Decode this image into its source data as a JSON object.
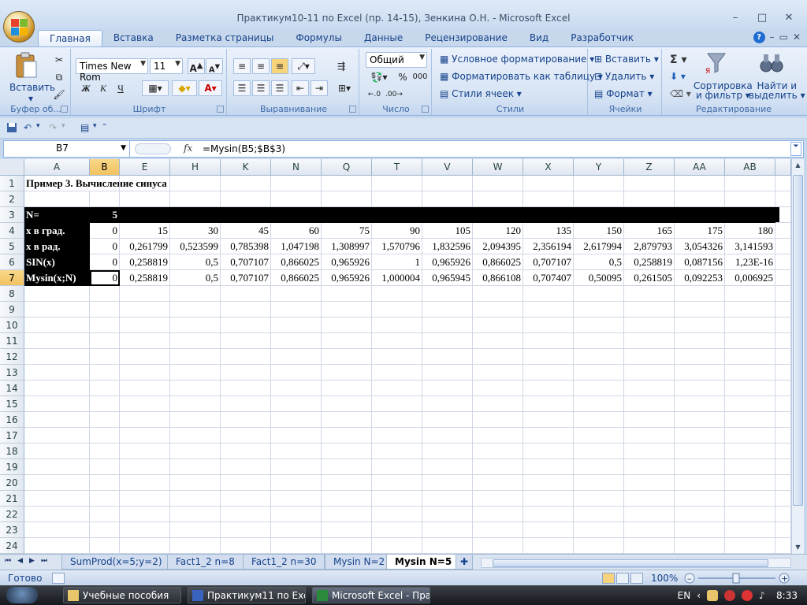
{
  "window": {
    "title": "Практикум10-11 по Excel (пр. 14-15), Зенкина О.Н. - Microsoft Excel",
    "controls": [
      "–",
      "□",
      "✕"
    ]
  },
  "tabs": [
    "Главная",
    "Вставка",
    "Разметка страницы",
    "Формулы",
    "Данные",
    "Рецензирование",
    "Вид",
    "Разработчик"
  ],
  "ribbon": {
    "clipboard": {
      "label": "Буфер об...",
      "paste": "Вставить"
    },
    "font": {
      "label": "Шрифт",
      "name": "Times New Rom",
      "size": "11",
      "bold": "Ж",
      "italic": "К",
      "underline": "Ч"
    },
    "alignment": {
      "label": "Выравнивание"
    },
    "number": {
      "label": "Число",
      "format": "Общий",
      "percent": "%",
      "thousands": "000"
    },
    "styles": {
      "label": "Стили",
      "conditional": "Условное форматирование",
      "table": "Форматировать как таблицу",
      "cell_styles": "Стили ячеек"
    },
    "cells": {
      "label": "Ячейки",
      "insert": "Вставить",
      "delete": "Удалить",
      "format": "Формат"
    },
    "editing": {
      "label": "Редактирование",
      "sort_1": "Сортировка",
      "sort_2": "и фильтр",
      "find_1": "Найти и",
      "find_2": "выделить",
      "sigma": "Σ"
    }
  },
  "formula_bar": {
    "name_box": "B7",
    "fx": "fx",
    "formula": "=Mysin(B5;$B$3)"
  },
  "columns": [
    "A",
    "B",
    "E",
    "H",
    "K",
    "N",
    "Q",
    "T",
    "V",
    "W",
    "X",
    "Y",
    "Z",
    "AA",
    "AB"
  ],
  "rows": [
    "1",
    "2",
    "3",
    "4",
    "5",
    "6",
    "7",
    "8",
    "9",
    "10",
    "11",
    "12",
    "13",
    "14",
    "15",
    "16",
    "17",
    "18",
    "19",
    "20",
    "21",
    "22",
    "23",
    "24"
  ],
  "cells": {
    "r1": {
      "A": "Пример 3. Вычисление синуса"
    },
    "r3": {
      "A": "N=",
      "B": "5"
    },
    "r4": [
      "x в град.",
      "0",
      "15",
      "30",
      "45",
      "60",
      "75",
      "90",
      "105",
      "120",
      "135",
      "150",
      "165",
      "175",
      "180"
    ],
    "r5": [
      "x  в рад.",
      "0",
      "0,261799",
      "0,523599",
      "0,785398",
      "1,047198",
      "1,308997",
      "1,570796",
      "1,832596",
      "2,094395",
      "2,356194",
      "2,617994",
      "2,879793",
      "3,054326",
      "3,141593"
    ],
    "r6": [
      "SIN(x)",
      "0",
      "0,258819",
      "0,5",
      "0,707107",
      "0,866025",
      "0,965926",
      "1",
      "0,965926",
      "0,866025",
      "0,707107",
      "0,5",
      "0,258819",
      "0,087156",
      "1,23E-16"
    ],
    "r7": [
      "Mysin(x;N)",
      "0",
      "0,258819",
      "0,5",
      "0,707107",
      "0,866025",
      "0,965926",
      "1,000004",
      "0,965945",
      "0,866108",
      "0,707407",
      "0,50095",
      "0,261505",
      "0,092253",
      "0,006925"
    ]
  },
  "sheets": [
    "SumProd(x=5;y=2)",
    "Fact1_2 n=8",
    "Fact1_2 n=30",
    "Mysin N=2",
    "Mysin N=5"
  ],
  "active_sheet": "Mysin N=5",
  "status": {
    "ready": "Готово",
    "zoom": "100%"
  },
  "taskbar": {
    "items": [
      "Учебные пособия",
      "Практикум11 по Exc...",
      "Microsoft Excel - Пра..."
    ],
    "lang": "EN",
    "clock": "8:33"
  }
}
